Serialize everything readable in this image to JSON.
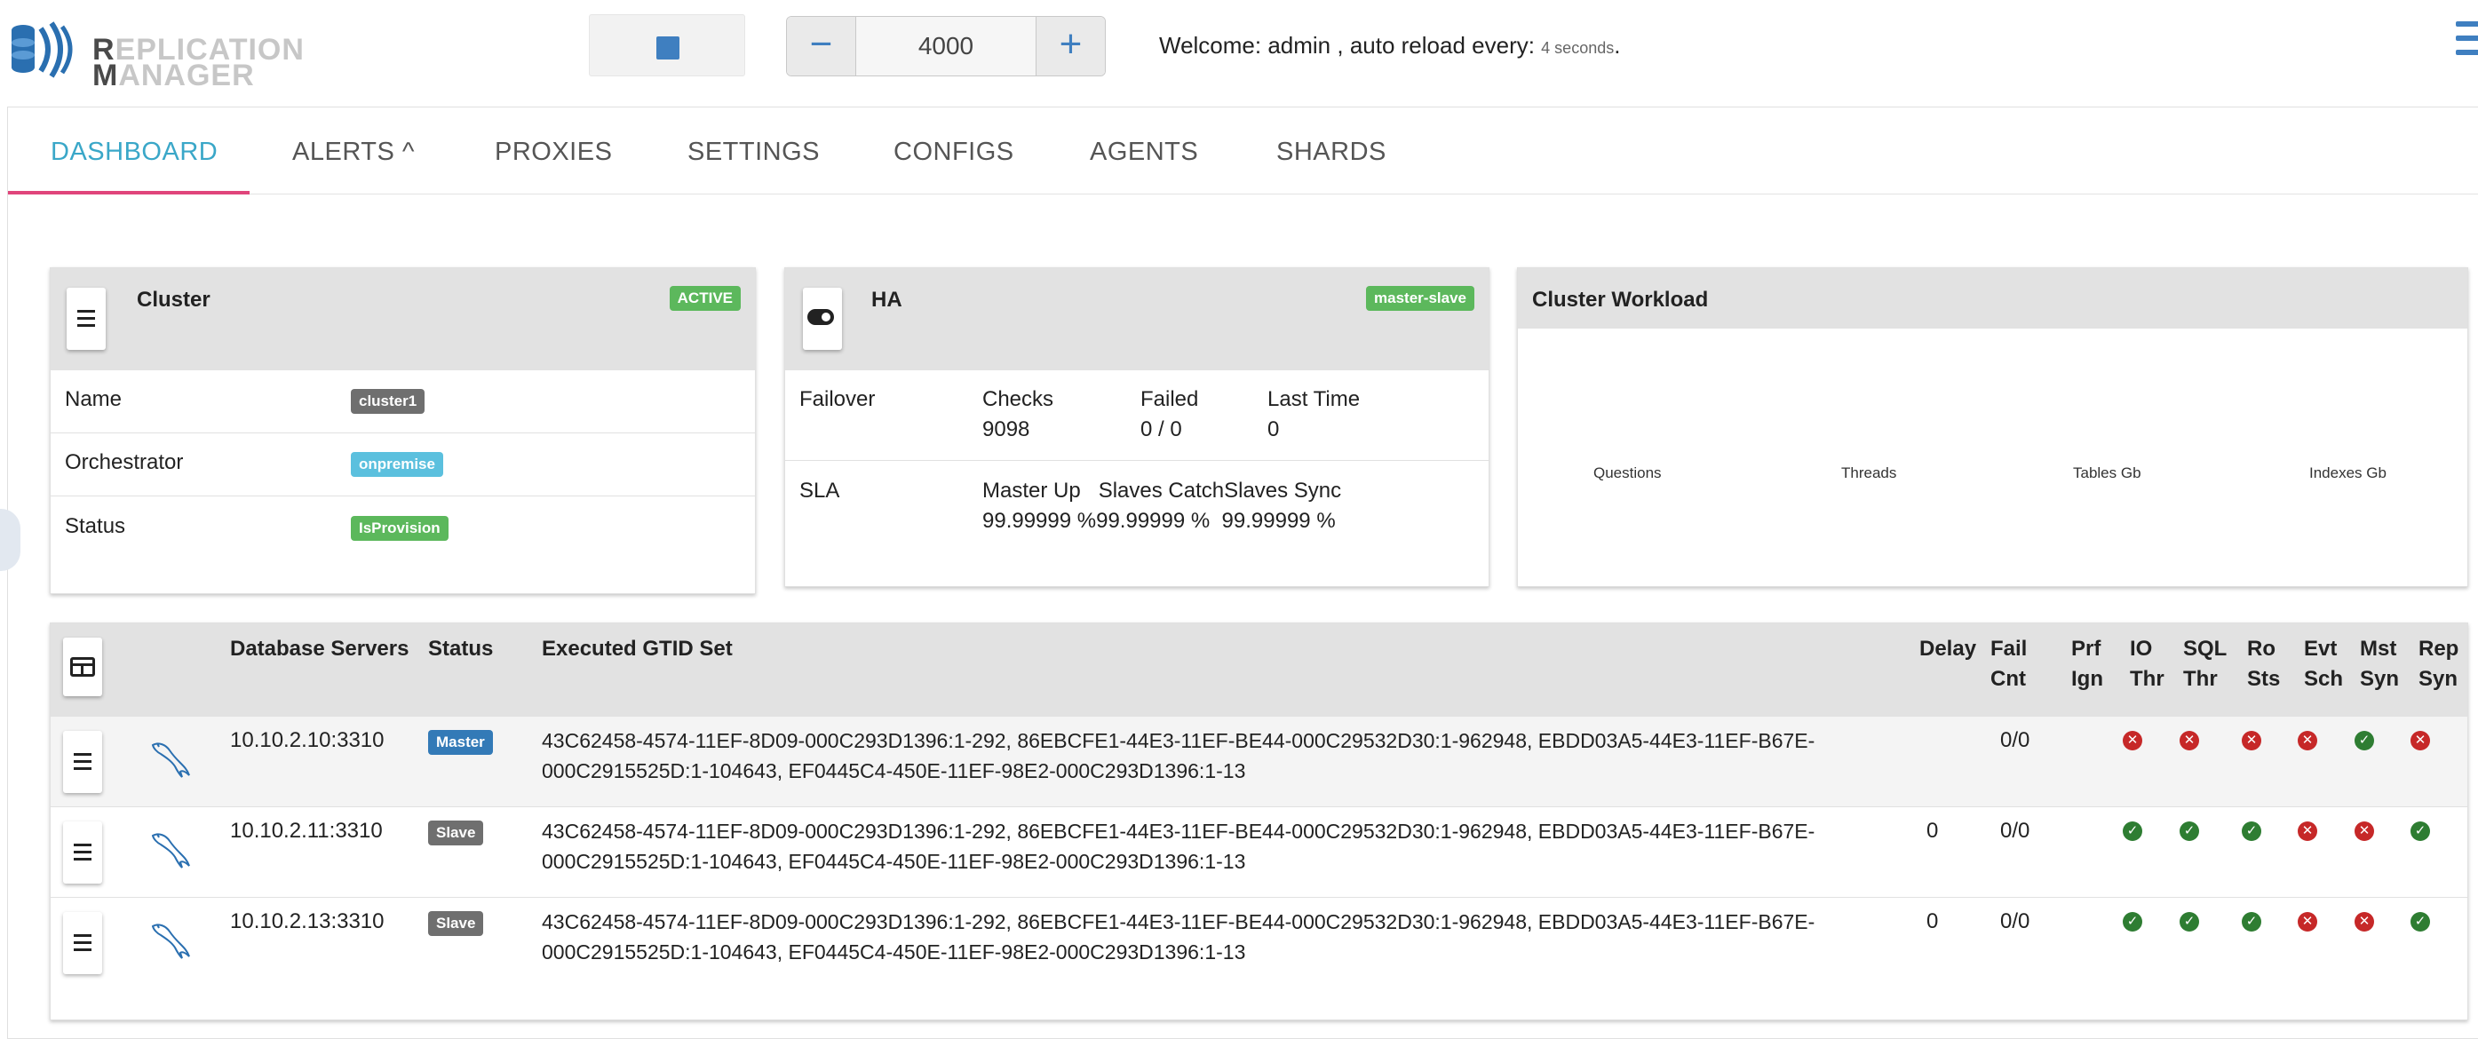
{
  "brand": {
    "line1_first": "R",
    "line1_rest": "EPLICATION",
    "line2_first": "M",
    "line2_rest": "ANAGER"
  },
  "toolbar": {
    "stop_icon": "stop-square-icon",
    "reload_value": "4000",
    "minus_label": "−",
    "plus_label": "+",
    "welcome_text": "Welcome: admin , auto reload every: ",
    "reload_seconds": "4 seconds",
    "welcome_end": "."
  },
  "colors": {
    "accent": "#3aa7c8",
    "tab_underline": "#e0457b",
    "ok": "#2e7d32",
    "error": "#c62828",
    "badge_green": "#5cb85c",
    "badge_blue": "#337ab7"
  },
  "tabs": [
    {
      "label": "DASHBOARD",
      "active": true
    },
    {
      "label": "ALERTS ^",
      "active": false
    },
    {
      "label": "PROXIES",
      "active": false
    },
    {
      "label": "SETTINGS",
      "active": false
    },
    {
      "label": "CONFIGS",
      "active": false
    },
    {
      "label": "AGENTS",
      "active": false
    },
    {
      "label": "SHARDS",
      "active": false
    }
  ],
  "cluster_card": {
    "title": "Cluster",
    "state_badge": "ACTIVE",
    "rows": [
      {
        "label": "Name",
        "value": "cluster1"
      },
      {
        "label": "Orchestrator",
        "value": "onpremise"
      },
      {
        "label": "Status",
        "value": "IsProvision"
      }
    ]
  },
  "ha_card": {
    "title": "HA",
    "mode_badge": "master-slave",
    "failover": {
      "label": "Failover",
      "checks_label": "Checks",
      "checks_value": "9098",
      "failed_label": "Failed",
      "failed_value": "0 / 0",
      "last_label": "Last Time",
      "last_value": "0"
    },
    "sla": {
      "label": "SLA",
      "header": "Master Up   Slaves CatchSlaves Sync",
      "values": "99.99999 %99.99999 %  99.99999 %"
    }
  },
  "workload_card": {
    "title": "Cluster Workload",
    "metrics": [
      "Questions",
      "Threads",
      "Tables Gb",
      "Indexes Gb"
    ]
  },
  "servers_table": {
    "columns": {
      "name": "Database Servers",
      "status": "Status",
      "gtid": "Executed GTID Set",
      "delay": "Delay",
      "fail_cnt": [
        "Fail",
        "Cnt"
      ],
      "prf_ign": [
        "Prf",
        "Ign"
      ],
      "io_thr": [
        "IO",
        "Thr"
      ],
      "sql_thr": [
        "SQL",
        "Thr"
      ],
      "ro_sts": [
        "Ro",
        "Sts"
      ],
      "evt_sch": [
        "Evt",
        "Sch"
      ],
      "mst_syn": [
        "Mst",
        "Syn"
      ],
      "rep_syn": [
        "Rep",
        "Syn"
      ]
    },
    "rows": [
      {
        "server": "10.10.2.10:3310",
        "status": "Master",
        "status_color": "#337ab7",
        "gtid": "43C62458-4574-11EF-8D09-000C293D1396:1-292, 86EBCFE1-44E3-11EF-BE44-000C29532D30:1-962948, EBDD03A5-44E3-11EF-B67E-000C2915525D:1-104643, EF0445C4-450E-11EF-98E2-000C293D1396:1-13",
        "delay": "",
        "fail_cnt": "0/0",
        "flags": [
          "bad",
          "bad",
          "bad",
          "bad",
          "ok",
          "bad"
        ]
      },
      {
        "server": "10.10.2.11:3310",
        "status": "Slave",
        "status_color": "#6f6f6f",
        "gtid": "43C62458-4574-11EF-8D09-000C293D1396:1-292, 86EBCFE1-44E3-11EF-BE44-000C29532D30:1-962948, EBDD03A5-44E3-11EF-B67E-000C2915525D:1-104643, EF0445C4-450E-11EF-98E2-000C293D1396:1-13",
        "delay": "0",
        "fail_cnt": "0/0",
        "flags": [
          "ok",
          "ok",
          "ok",
          "bad",
          "bad",
          "ok"
        ]
      },
      {
        "server": "10.10.2.13:3310",
        "status": "Slave",
        "status_color": "#6f6f6f",
        "gtid": "43C62458-4574-11EF-8D09-000C293D1396:1-292, 86EBCFE1-44E3-11EF-BE44-000C29532D30:1-962948, EBDD03A5-44E3-11EF-B67E-000C2915525D:1-104643, EF0445C4-450E-11EF-98E2-000C293D1396:1-13",
        "delay": "0",
        "fail_cnt": "0/0",
        "flags": [
          "ok",
          "ok",
          "ok",
          "bad",
          "bad",
          "ok"
        ]
      }
    ]
  }
}
